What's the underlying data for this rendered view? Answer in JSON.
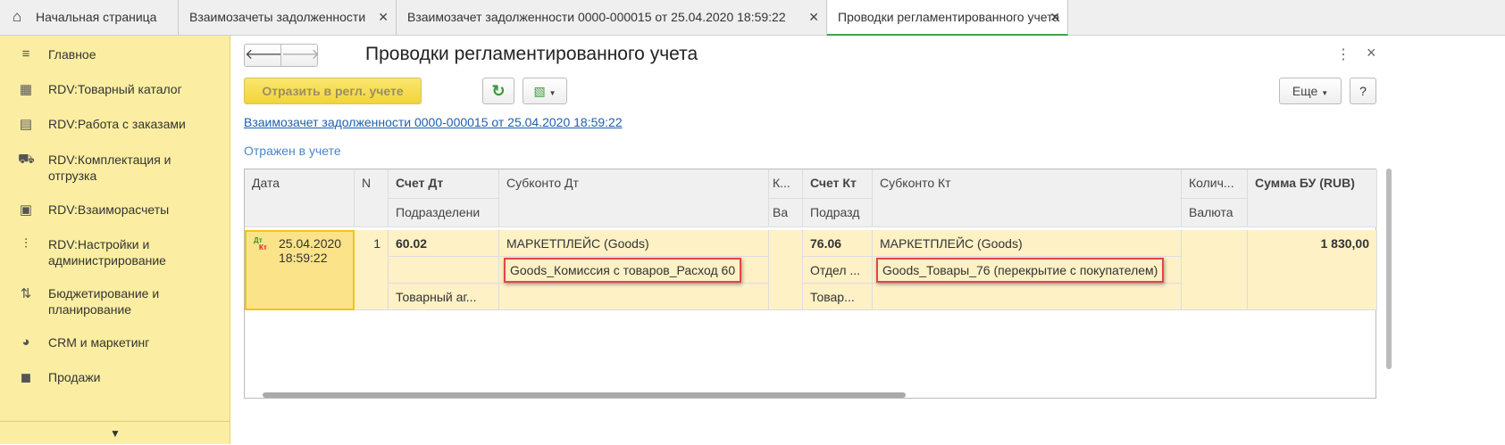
{
  "tabs": [
    {
      "label": "Начальная страница",
      "icon": "home-icon"
    },
    {
      "label": "Взаимозачеты задолженности"
    },
    {
      "label": "Взаимозачет задолженности 0000-000015 от 25.04.2020 18:59:22"
    },
    {
      "label": "Проводки регламентированного учета",
      "active": true
    }
  ],
  "sidebar": {
    "items": [
      {
        "label": "Главное",
        "icon": "menu-icon"
      },
      {
        "label": "RDV:Товарный каталог",
        "icon": "catalog-icon"
      },
      {
        "label": "RDV:Работа с заказами",
        "icon": "orders-icon"
      },
      {
        "label": "RDV:Комплектация и отгрузка",
        "icon": "shipping-icon"
      },
      {
        "label": "RDV:Взаиморасчеты",
        "icon": "calculator-icon"
      },
      {
        "label": "RDV:Настройки и администрирование",
        "icon": "settings-icon"
      },
      {
        "label": "Бюджетирование и планирование",
        "icon": "budget-icon"
      },
      {
        "label": "CRM и маркетинг",
        "icon": "crm-icon"
      },
      {
        "label": "Продажи",
        "icon": "bag-icon"
      }
    ],
    "more": "▼"
  },
  "header": {
    "title": "Проводки регламентированного учета",
    "back": "🡐",
    "forward": "🡒",
    "more": "⋮",
    "close": "×"
  },
  "toolbar": {
    "post_label": "Отразить в регл. учете",
    "refresh": "↻",
    "more_label": "Еще",
    "help": "?"
  },
  "link": "Взаимозачет задолженности 0000-000015 от 25.04.2020 18:59:22",
  "status": "Отражен в учете",
  "table": {
    "headers": {
      "date": "Дата",
      "n": "N",
      "acc_dt": "Счет Дт",
      "dept_dt": "Подразделени",
      "sub_dt": "Субконто Дт",
      "k": "К...",
      "va": "Ва",
      "acc_kt": "Счет Кт",
      "dept_kt": "Подразд",
      "sub_kt": "Субконто Кт",
      "qty": "Колич...",
      "currency": "Валюта",
      "sum": "Сумма БУ (RUB)"
    },
    "rows": [
      {
        "dt_mark": "Дт",
        "kt_mark": "Кт",
        "date": "25.04.2020",
        "time": "18:59:22",
        "n": "1",
        "acc_dt": "60.02",
        "sub_dt_1": "МАРКЕТПЛЕЙС (Goods)",
        "sub_dt_2": "Goods_Комиссия с товаров_Расход 60",
        "dept_dt": "Товарный аг...",
        "acc_kt": "76.06",
        "sub_kt_1": "МАРКЕТПЛЕЙС (Goods)",
        "sub_kt_2": "Goods_Товары_76 (перекрытие с покупателем)",
        "dept_kt_1": "Отдел ...",
        "dept_kt_2": "Товар...",
        "sum": "1 830,00"
      }
    ]
  }
}
